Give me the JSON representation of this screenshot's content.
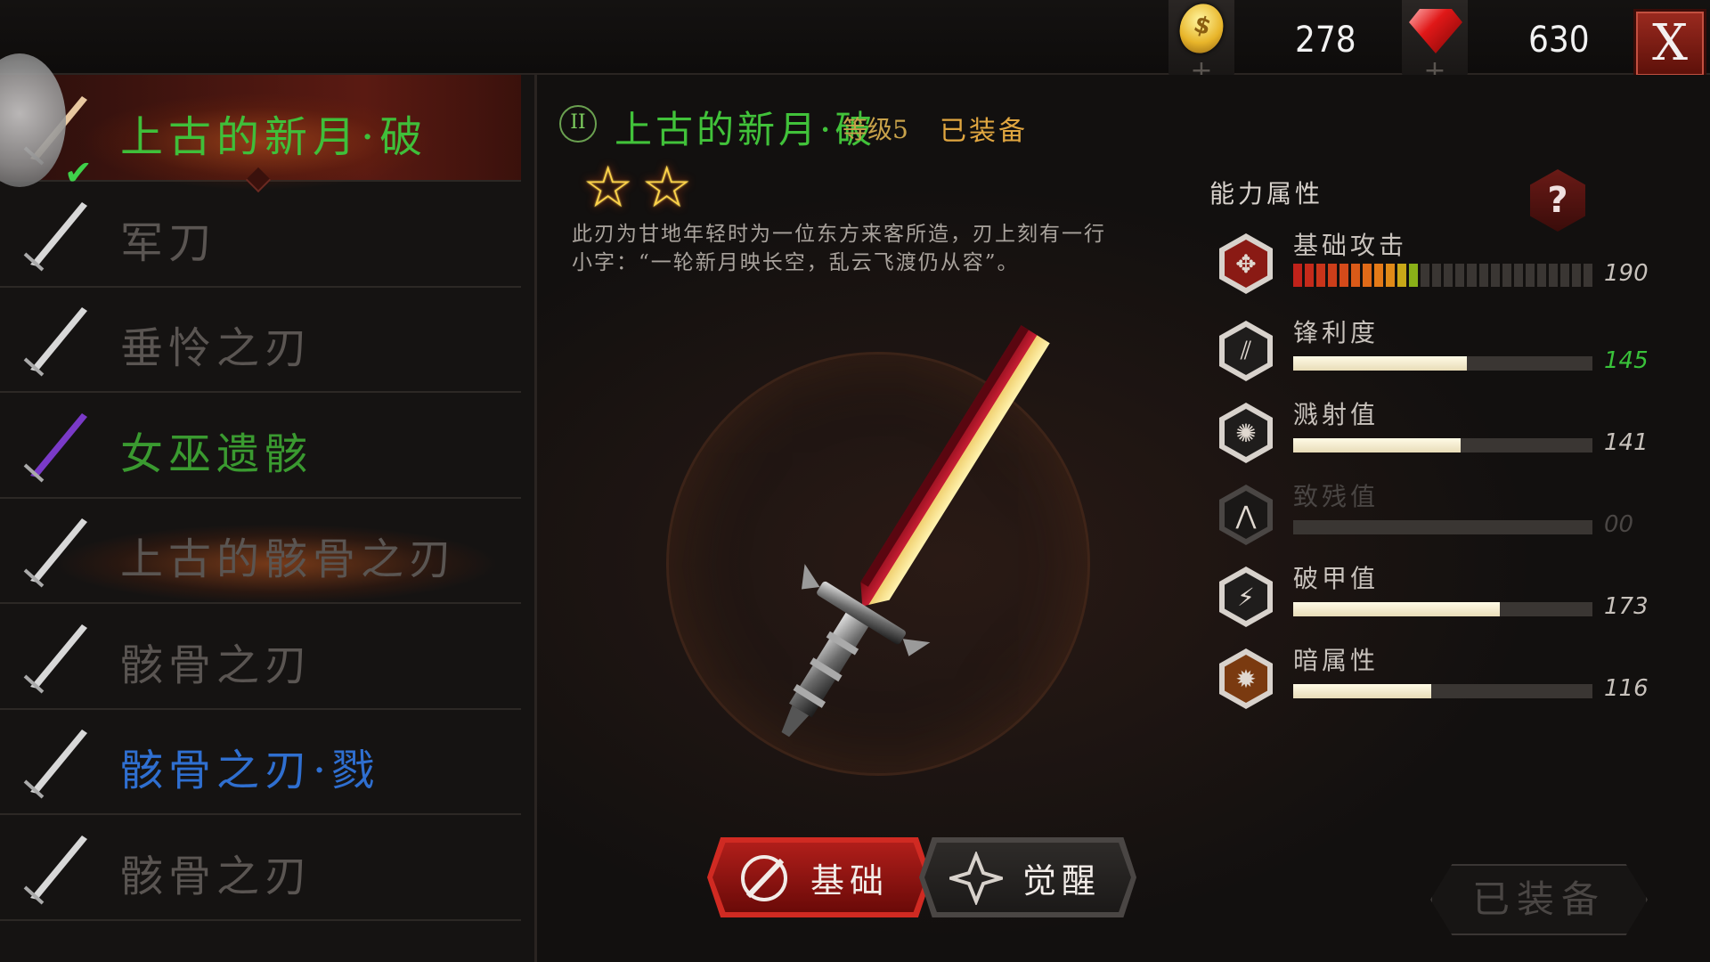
{
  "topbar": {
    "gold": "278",
    "gems": "630",
    "close_label": "X",
    "plus_label": "+",
    "coin_glyph": "$"
  },
  "weapon_list": [
    {
      "label": "上古的新月·破",
      "color": "#3fbf3a",
      "selected": true,
      "equipped": true
    },
    {
      "label": "军刀",
      "color": "#5a5552"
    },
    {
      "label": "垂怜之刃",
      "color": "#5a5552"
    },
    {
      "label": "女巫遗骸",
      "color": "#3a9a30"
    },
    {
      "label": "上古的骸骨之刃",
      "color": "#5a5552"
    },
    {
      "label": "骸骨之刃",
      "color": "#5a5552"
    },
    {
      "label": "骸骨之刃·戮",
      "color": "#2f6fd0"
    },
    {
      "label": "骸骨之刃",
      "color": "#5a5552"
    }
  ],
  "detail": {
    "rank": "II",
    "name": "上古的新月·破",
    "level": "等级5",
    "equipped_label": "已装备",
    "stars": 2,
    "star_glyph": "☆",
    "description": "此刃为甘地年轻时为一位东方来客所造，刃上刻有一行小字：“一轮新月映长空，乱云飞渡仍从容”。"
  },
  "stats": {
    "title": "能力属性",
    "help": "?",
    "items": [
      {
        "label": "基础攻击",
        "value": "190",
        "icon": "attack-icon",
        "glyph": "✥",
        "segmented": true,
        "fill_segments": 11,
        "total_segments": 26,
        "value_color": "#c8c2bc"
      },
      {
        "label": "锋利度",
        "value": "145",
        "icon": "sharpness-icon",
        "glyph": "⫽",
        "fraction": 0.58,
        "value_color": "#39c23a"
      },
      {
        "label": "溅射值",
        "value": "141",
        "icon": "splash-icon",
        "glyph": "✺",
        "fraction": 0.56,
        "value_color": "#c8c2bc"
      },
      {
        "label": "致残值",
        "value": "00",
        "icon": "cripple-icon",
        "glyph": "⋀",
        "fraction": 0,
        "disabled": true,
        "value_color": "#4a4644"
      },
      {
        "label": "破甲值",
        "value": "173",
        "icon": "armor-break-icon",
        "glyph": "⚡",
        "fraction": 0.69,
        "value_color": "#c8c2bc"
      },
      {
        "label": "暗属性",
        "value": "116",
        "icon": "dark-element-icon",
        "glyph": "✹",
        "fraction": 0.46,
        "value_color": "#c8c2bc"
      }
    ]
  },
  "tabs": {
    "basic": "基础",
    "awaken": "觉醒"
  },
  "equip_button": "已装备",
  "colors": {
    "accent_red": "#b01e1a",
    "title_green": "#41c23a",
    "gold": "#e0a640"
  }
}
